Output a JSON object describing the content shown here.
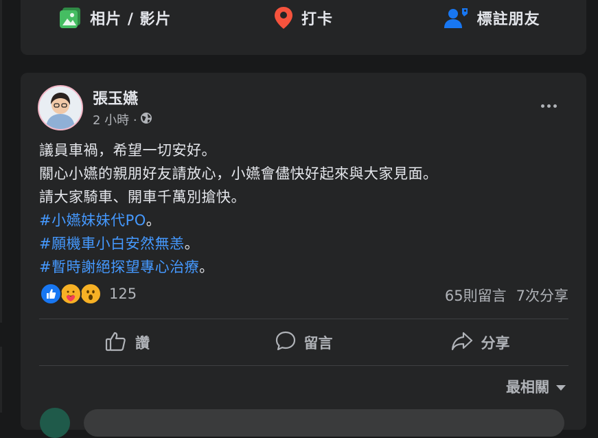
{
  "composer": {
    "photo_label": "相片 / 影片",
    "checkin_label": "打卡",
    "tag_label": "標註朋友"
  },
  "post": {
    "author": "張玉嬿",
    "time": "2 小時 ·",
    "audience_icon": "globe-icon",
    "lines": [
      "議員車禍，希望一切安好。",
      "關心小嬿的親朋好友請放心，小嬿會儘快好起來與大家見面。",
      "請大家騎車、開車千萬別搶快。"
    ],
    "hashtags": [
      {
        "tag": "#小嬿妹妹代PO",
        "suffix": "。"
      },
      {
        "tag": "#願機車小白安然無恙",
        "suffix": "。"
      },
      {
        "tag": "#暫時謝絕探望專心治療",
        "suffix": "。"
      }
    ],
    "reaction_icons": [
      "like-reaction",
      "care-reaction",
      "wow-reaction"
    ],
    "reaction_count": "125",
    "comments_count": "65則留言",
    "shares_count": "7次分享",
    "actions": {
      "like": "讚",
      "comment": "留言",
      "share": "分享"
    },
    "sort_label": "最相關"
  },
  "colors": {
    "background": "#18191a",
    "card": "#242526",
    "text": "#e4e6eb",
    "secondary_text": "#b0b3b8",
    "link": "#4599ff",
    "photo_green": "#45bd62",
    "checkin_red": "#f5533d",
    "tag_blue": "#1877f2"
  }
}
